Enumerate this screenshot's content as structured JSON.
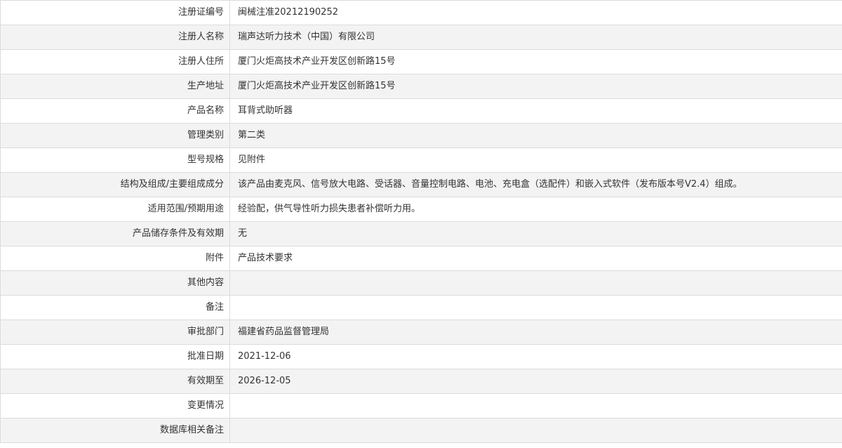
{
  "rows": [
    {
      "label": "注册证编号",
      "value": "闽械注准20212190252"
    },
    {
      "label": "注册人名称",
      "value": "瑞声达听力技术（中国）有限公司"
    },
    {
      "label": "注册人住所",
      "value": "厦门火炬高技术产业开发区创新路15号"
    },
    {
      "label": "生产地址",
      "value": "厦门火炬高技术产业开发区创新路15号"
    },
    {
      "label": "产品名称",
      "value": "耳背式助听器"
    },
    {
      "label": "管理类别",
      "value": "第二类"
    },
    {
      "label": "型号规格",
      "value": "见附件"
    },
    {
      "label": "结构及组成/主要组成成分",
      "value": "该产品由麦克风、信号放大电路、受话器、音量控制电路、电池、充电盒（选配件）和嵌入式软件（发布版本号V2.4）组成。"
    },
    {
      "label": "适用范围/预期用途",
      "value": "经验配，供气导性听力损失患者补偿听力用。"
    },
    {
      "label": "产品储存条件及有效期",
      "value": "无"
    },
    {
      "label": "附件",
      "value": "产品技术要求"
    },
    {
      "label": "其他内容",
      "value": ""
    },
    {
      "label": "备注",
      "value": ""
    },
    {
      "label": "审批部门",
      "value": "福建省药品监督管理局"
    },
    {
      "label": "批准日期",
      "value": "2021-12-06"
    },
    {
      "label": "有效期至",
      "value": "2026-12-05"
    },
    {
      "label": "变更情况",
      "value": ""
    },
    {
      "label": "数据库相关备注",
      "value": ""
    }
  ]
}
